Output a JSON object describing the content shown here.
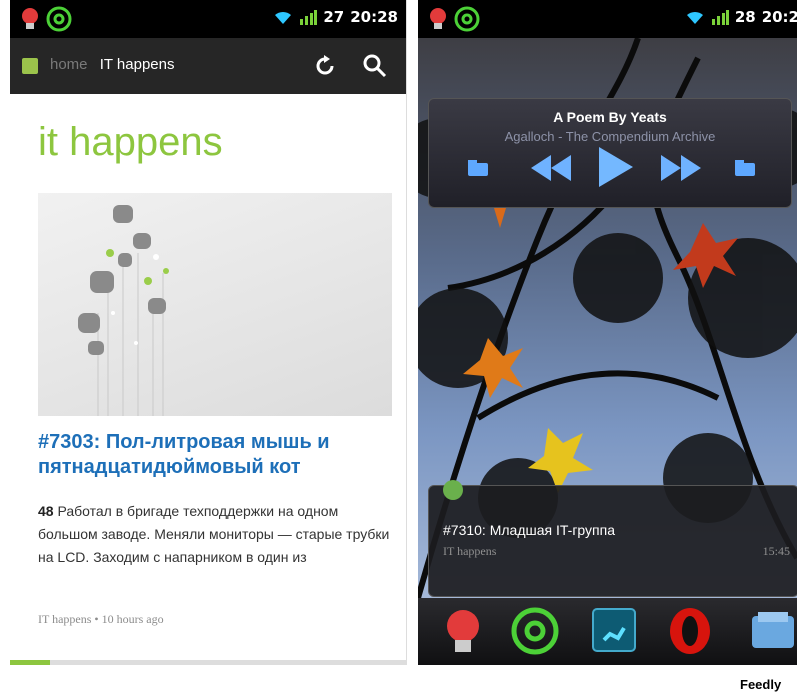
{
  "left_screen": {
    "status_bar": {
      "battery": "27",
      "time": "20:28",
      "icons": [
        "bulb-icon",
        "at-icon",
        "wifi-icon",
        "signal-icon"
      ]
    },
    "action_bar": {
      "home_label": "home",
      "title": "IT happens",
      "icons": [
        "app-icon",
        "refresh-icon",
        "search-icon"
      ]
    },
    "section_title": "it happens",
    "story": {
      "title": "#7303: Пол-литровая мышь и пятнадцатидюймовый кот",
      "count": "48",
      "text": "Работал в бригаде техподдержки на одном большом заводе. Меняли мониторы — старые трубки на LCD. Заходим с напарником в один из",
      "meta": "IT happens • 10 hours ago"
    },
    "progress_fraction": 0.1
  },
  "right_screen": {
    "status_bar": {
      "battery": "28",
      "time": "20:2"
    },
    "player": {
      "track": "A Poem By Yeats",
      "artist_album": "Agalloch - The Compendium Archive",
      "controls": [
        "folder-prev-icon",
        "rewind-icon",
        "play-icon",
        "fast-forward-icon",
        "folder-next-icon"
      ]
    },
    "feed_widget": {
      "title": "#7310: Младшая IT-группа",
      "source": "IT happens",
      "time": "15:45"
    },
    "dock": [
      "bulb-icon",
      "at-icon",
      "phone-icon",
      "opera-icon",
      "files-icon"
    ]
  },
  "caption": "Feedly",
  "colors": {
    "accent_green": "#8dc63f",
    "title_blue": "#1d6fb8",
    "action_bar": "#262626"
  }
}
